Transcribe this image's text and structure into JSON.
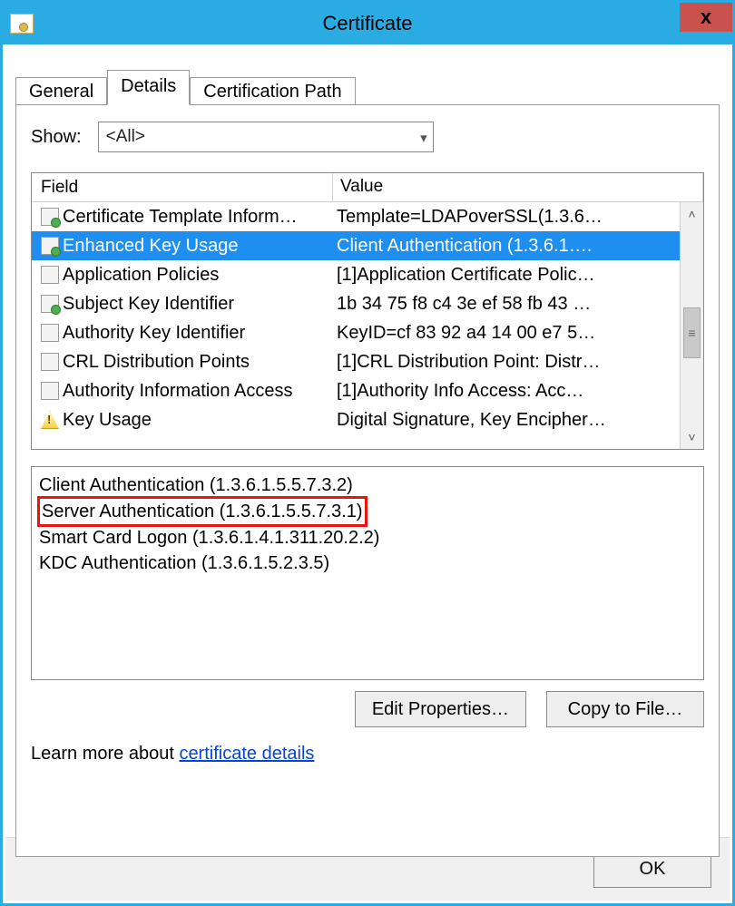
{
  "window": {
    "title": "Certificate",
    "close_glyph": "x"
  },
  "tabs": {
    "general": "General",
    "details": "Details",
    "certpath": "Certification Path",
    "active": "details"
  },
  "show": {
    "label": "Show:",
    "value": "<All>"
  },
  "list": {
    "header_field": "Field",
    "header_value": "Value",
    "rows": [
      {
        "icon": "doc",
        "field": "Certificate Template Inform…",
        "value": "Template=LDAPoverSSL(1.3.6…",
        "selected": false
      },
      {
        "icon": "doc",
        "field": "Enhanced Key Usage",
        "value": "Client Authentication (1.3.6.1….",
        "selected": true
      },
      {
        "icon": "docn",
        "field": "Application Policies",
        "value": "[1]Application Certificate Polic…",
        "selected": false
      },
      {
        "icon": "doc",
        "field": "Subject Key Identifier",
        "value": "1b 34 75 f8 c4 3e ef 58 fb 43 …",
        "selected": false
      },
      {
        "icon": "docn",
        "field": "Authority Key Identifier",
        "value": "KeyID=cf 83 92 a4 14 00 e7 5…",
        "selected": false
      },
      {
        "icon": "docn",
        "field": "CRL Distribution Points",
        "value": "[1]CRL Distribution Point: Distr…",
        "selected": false
      },
      {
        "icon": "docn",
        "field": "Authority Information Access",
        "value": "[1]Authority Info Access: Acc…",
        "selected": false
      },
      {
        "icon": "warn",
        "field": "Key Usage",
        "value": "Digital Signature, Key Encipher…",
        "selected": false
      }
    ]
  },
  "detail": {
    "lines": [
      "Client Authentication (1.3.6.1.5.5.7.3.2)",
      "Server Authentication (1.3.6.1.5.5.7.3.1)",
      "Smart Card Logon (1.3.6.1.4.1.311.20.2.2)",
      "KDC Authentication (1.3.6.1.5.2.3.5)"
    ],
    "highlight_index": 1
  },
  "buttons": {
    "edit": "Edit Properties…",
    "copy": "Copy to File…",
    "ok": "OK"
  },
  "learn": {
    "prefix": "Learn more about ",
    "link": "certificate details"
  }
}
